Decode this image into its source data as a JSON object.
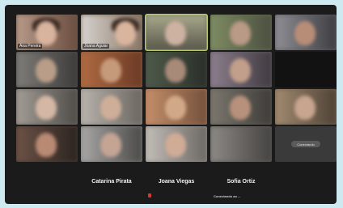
{
  "participants": {
    "ana": "Ana Pereira",
    "joana_a": "Joana Aguiar",
    "catarina": "Catarina Pirata",
    "joana_v": "Joana Viegas",
    "sofia": "Sofia Ortiz",
    "sofia_status": "Conectando ao ...",
    "unknown_pill": "Conectando"
  },
  "colors": {
    "active_speaker": "#b7c86a",
    "mic_muted": "#d33333"
  },
  "icons": [
    "mic-muted-icon"
  ]
}
